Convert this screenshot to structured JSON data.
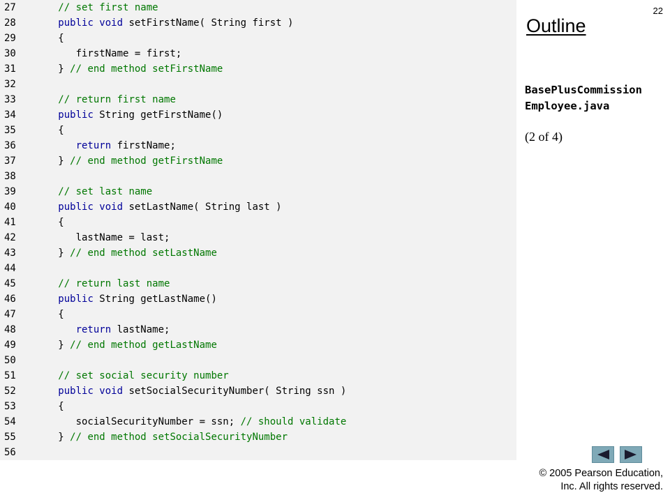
{
  "page_number": "22",
  "outline": {
    "title": "Outline",
    "file_title_line1": "BasePlusCommission",
    "file_title_line2": "Employee.java",
    "part_label": "(2 of 4)"
  },
  "navigation": {
    "prev_icon": "arrow-left-icon",
    "next_icon": "arrow-right-icon",
    "button_color": "#7fa9b7",
    "arrow_color": "#1a1a2e"
  },
  "copyright": {
    "line1": "© 2005 Pearson Education,",
    "line2": "Inc.  All rights reserved."
  },
  "code": {
    "colors": {
      "keyword": "#000099",
      "comment": "#007700",
      "plain": "#000000",
      "panel": "#f2f2f2"
    },
    "lines": [
      {
        "num": "27",
        "segs": [
          {
            "t": "   ",
            "k": "plain"
          },
          {
            "t": "// set first name",
            "k": "comment"
          }
        ]
      },
      {
        "num": "28",
        "segs": [
          {
            "t": "   ",
            "k": "plain"
          },
          {
            "t": "public void",
            "k": "keyword"
          },
          {
            "t": " setFirstName( String first )",
            "k": "plain"
          }
        ]
      },
      {
        "num": "29",
        "segs": [
          {
            "t": "   {",
            "k": "plain"
          }
        ]
      },
      {
        "num": "30",
        "segs": [
          {
            "t": "      firstName = first;",
            "k": "plain"
          }
        ]
      },
      {
        "num": "31",
        "segs": [
          {
            "t": "   } ",
            "k": "plain"
          },
          {
            "t": "// end method setFirstName",
            "k": "comment"
          }
        ]
      },
      {
        "num": "32",
        "segs": []
      },
      {
        "num": "33",
        "segs": [
          {
            "t": "   ",
            "k": "plain"
          },
          {
            "t": "// return first name",
            "k": "comment"
          }
        ]
      },
      {
        "num": "34",
        "segs": [
          {
            "t": "   ",
            "k": "plain"
          },
          {
            "t": "public",
            "k": "keyword"
          },
          {
            "t": " String getFirstName()",
            "k": "plain"
          }
        ]
      },
      {
        "num": "35",
        "segs": [
          {
            "t": "   {",
            "k": "plain"
          }
        ]
      },
      {
        "num": "36",
        "segs": [
          {
            "t": "      ",
            "k": "plain"
          },
          {
            "t": "return",
            "k": "keyword"
          },
          {
            "t": " firstName;",
            "k": "plain"
          }
        ]
      },
      {
        "num": "37",
        "segs": [
          {
            "t": "   } ",
            "k": "plain"
          },
          {
            "t": "// end method getFirstName",
            "k": "comment"
          }
        ]
      },
      {
        "num": "38",
        "segs": []
      },
      {
        "num": "39",
        "segs": [
          {
            "t": "   ",
            "k": "plain"
          },
          {
            "t": "// set last name",
            "k": "comment"
          }
        ]
      },
      {
        "num": "40",
        "segs": [
          {
            "t": "   ",
            "k": "plain"
          },
          {
            "t": "public void",
            "k": "keyword"
          },
          {
            "t": " setLastName( String last )",
            "k": "plain"
          }
        ]
      },
      {
        "num": "41",
        "segs": [
          {
            "t": "   {",
            "k": "plain"
          }
        ]
      },
      {
        "num": "42",
        "segs": [
          {
            "t": "      lastName = last;",
            "k": "plain"
          }
        ]
      },
      {
        "num": "43",
        "segs": [
          {
            "t": "   } ",
            "k": "plain"
          },
          {
            "t": "// end method setLastName",
            "k": "comment"
          }
        ]
      },
      {
        "num": "44",
        "segs": []
      },
      {
        "num": "45",
        "segs": [
          {
            "t": "   ",
            "k": "plain"
          },
          {
            "t": "// return last name",
            "k": "comment"
          }
        ]
      },
      {
        "num": "46",
        "segs": [
          {
            "t": "   ",
            "k": "plain"
          },
          {
            "t": "public",
            "k": "keyword"
          },
          {
            "t": " String getLastName()",
            "k": "plain"
          }
        ]
      },
      {
        "num": "47",
        "segs": [
          {
            "t": "   {",
            "k": "plain"
          }
        ]
      },
      {
        "num": "48",
        "segs": [
          {
            "t": "      ",
            "k": "plain"
          },
          {
            "t": "return",
            "k": "keyword"
          },
          {
            "t": " lastName;",
            "k": "plain"
          }
        ]
      },
      {
        "num": "49",
        "segs": [
          {
            "t": "   } ",
            "k": "plain"
          },
          {
            "t": "// end method getLastName",
            "k": "comment"
          }
        ]
      },
      {
        "num": "50",
        "segs": []
      },
      {
        "num": "51",
        "segs": [
          {
            "t": "   ",
            "k": "plain"
          },
          {
            "t": "// set social security number",
            "k": "comment"
          }
        ]
      },
      {
        "num": "52",
        "segs": [
          {
            "t": "   ",
            "k": "plain"
          },
          {
            "t": "public void",
            "k": "keyword"
          },
          {
            "t": " setSocialSecurityNumber( String ssn )",
            "k": "plain"
          }
        ]
      },
      {
        "num": "53",
        "segs": [
          {
            "t": "   {",
            "k": "plain"
          }
        ]
      },
      {
        "num": "54",
        "segs": [
          {
            "t": "      socialSecurityNumber = ssn; ",
            "k": "plain"
          },
          {
            "t": "// should validate",
            "k": "comment"
          }
        ]
      },
      {
        "num": "55",
        "segs": [
          {
            "t": "   } ",
            "k": "plain"
          },
          {
            "t": "// end method setSocialSecurityNumber",
            "k": "comment"
          }
        ]
      },
      {
        "num": "56",
        "segs": []
      }
    ]
  }
}
